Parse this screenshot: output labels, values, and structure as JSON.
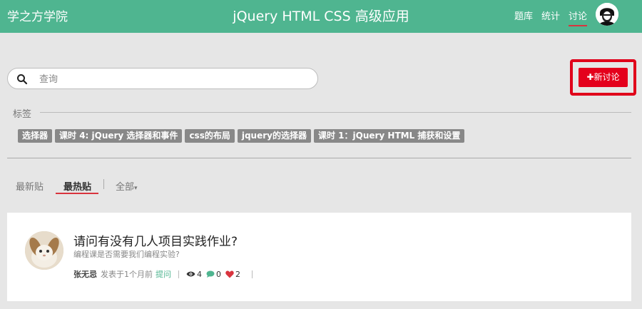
{
  "header": {
    "brand": "学之方学院",
    "title": "jQuery HTML CSS 高级应用",
    "nav": [
      "题库",
      "统计",
      "讨论"
    ]
  },
  "search": {
    "placeholder": "查询",
    "value": ""
  },
  "new_button": {
    "label": "新讨论"
  },
  "tags": {
    "label": "标签",
    "items": [
      "选择器",
      "课时 4: jQuery 选择器和事件",
      "css的布局",
      "jquery的选择器",
      "课时 1：jQuery HTML 捕获和设置"
    ]
  },
  "tabs": {
    "latest": "最新贴",
    "hot": "最热贴",
    "all": "全部"
  },
  "post": {
    "title": "请问有没有几人项目实践作业?",
    "subtitle": "编程课是否需要我们编程实验?",
    "author": "张无忌",
    "posted": "发表于1个月前",
    "type": "提问",
    "views": "4",
    "comments": "0",
    "likes": "2"
  },
  "colors": {
    "accent": "#4fb590",
    "highlight": "#e0001a"
  }
}
